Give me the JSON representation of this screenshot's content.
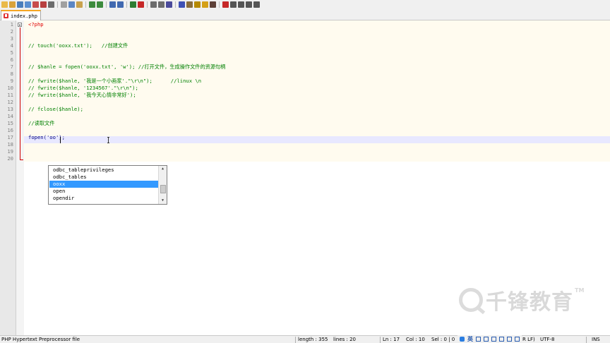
{
  "tab": {
    "filename": "index.php"
  },
  "editor": {
    "lines": [
      {
        "n": "1",
        "text": "<?php",
        "kind": "php"
      },
      {
        "n": "2",
        "text": "",
        "kind": "comment"
      },
      {
        "n": "3",
        "text": "",
        "kind": "comment"
      },
      {
        "n": "4",
        "text": "// touch('ooxx.txt');   //创建文件",
        "kind": "comment"
      },
      {
        "n": "5",
        "text": "",
        "kind": "comment"
      },
      {
        "n": "6",
        "text": "",
        "kind": "comment"
      },
      {
        "n": "7",
        "text": "// $hanle = fopen('ooxx.txt', 'w'); //打开文件，生成操作文件的资源句柄",
        "kind": "comment"
      },
      {
        "n": "8",
        "text": "",
        "kind": "comment"
      },
      {
        "n": "9",
        "text": "// fwrite($hanle, '我是一个小画家'.\"\\r\\n\");      //linux \\n",
        "kind": "comment"
      },
      {
        "n": "10",
        "text": "// fwrite($hanle, '1234567'.\"\\r\\n\");",
        "kind": "comment"
      },
      {
        "n": "11",
        "text": "// fwrite($hanle, '我今天心情非常好');",
        "kind": "comment"
      },
      {
        "n": "12",
        "text": "",
        "kind": "comment"
      },
      {
        "n": "13",
        "text": "// fclose($hanle);",
        "kind": "comment"
      },
      {
        "n": "14",
        "text": "",
        "kind": "comment"
      },
      {
        "n": "15",
        "text": "//读取文件",
        "kind": "comment"
      },
      {
        "n": "16",
        "text": "",
        "kind": "comment"
      },
      {
        "n": "17",
        "text": "fopen('oo');",
        "kind": "normal"
      },
      {
        "n": "18",
        "text": "",
        "kind": "normal"
      },
      {
        "n": "19",
        "text": "",
        "kind": "normal"
      },
      {
        "n": "20",
        "text": "",
        "kind": "normal"
      }
    ]
  },
  "autocomplete": {
    "items": [
      "odbc_tableprivileges",
      "odbc_tables",
      "ooxx",
      "open",
      "opendir"
    ],
    "selected_index": 2,
    "arrow_up": "▲",
    "arrow_down": "▼"
  },
  "watermark": {
    "text": "千锋教育",
    "tm": "TM"
  },
  "status": {
    "file_type": "PHP Hypertext Preprocessor file",
    "length": "length : 355",
    "lines": "lines : 20",
    "ln": "Ln : 17",
    "col": "Col : 10",
    "sel": "Sel : 0 | 0",
    "eol": "R LF)",
    "encoding": "UTF-8",
    "mode": "INS"
  },
  "ime": {
    "lang": "英"
  },
  "colors": {
    "comment": "#008000",
    "code": "#000080",
    "php_tag": "#e00000",
    "selection": "#3399ff",
    "caret_line": "#e8e8ff",
    "code_bg": "#fffbef",
    "tab_accent": "#f5a623"
  },
  "icons": [
    "new-file-icon",
    "open-icon",
    "save-icon",
    "save-all-icon",
    "close-icon",
    "close-all-icon",
    "print-icon",
    "cut-icon",
    "copy-icon",
    "paste-icon",
    "undo-icon",
    "redo-icon",
    "find-icon",
    "replace-icon",
    "zoom-in-icon",
    "zoom-out-icon",
    "sync-v-icon",
    "sync-h-icon",
    "wrap-icon",
    "all-chars-icon",
    "indent-guide-icon",
    "lang-icon",
    "folder-icon",
    "monitor-icon",
    "record-icon",
    "stop-icon",
    "play-icon",
    "play-multi-icon",
    "save-macro-icon"
  ]
}
